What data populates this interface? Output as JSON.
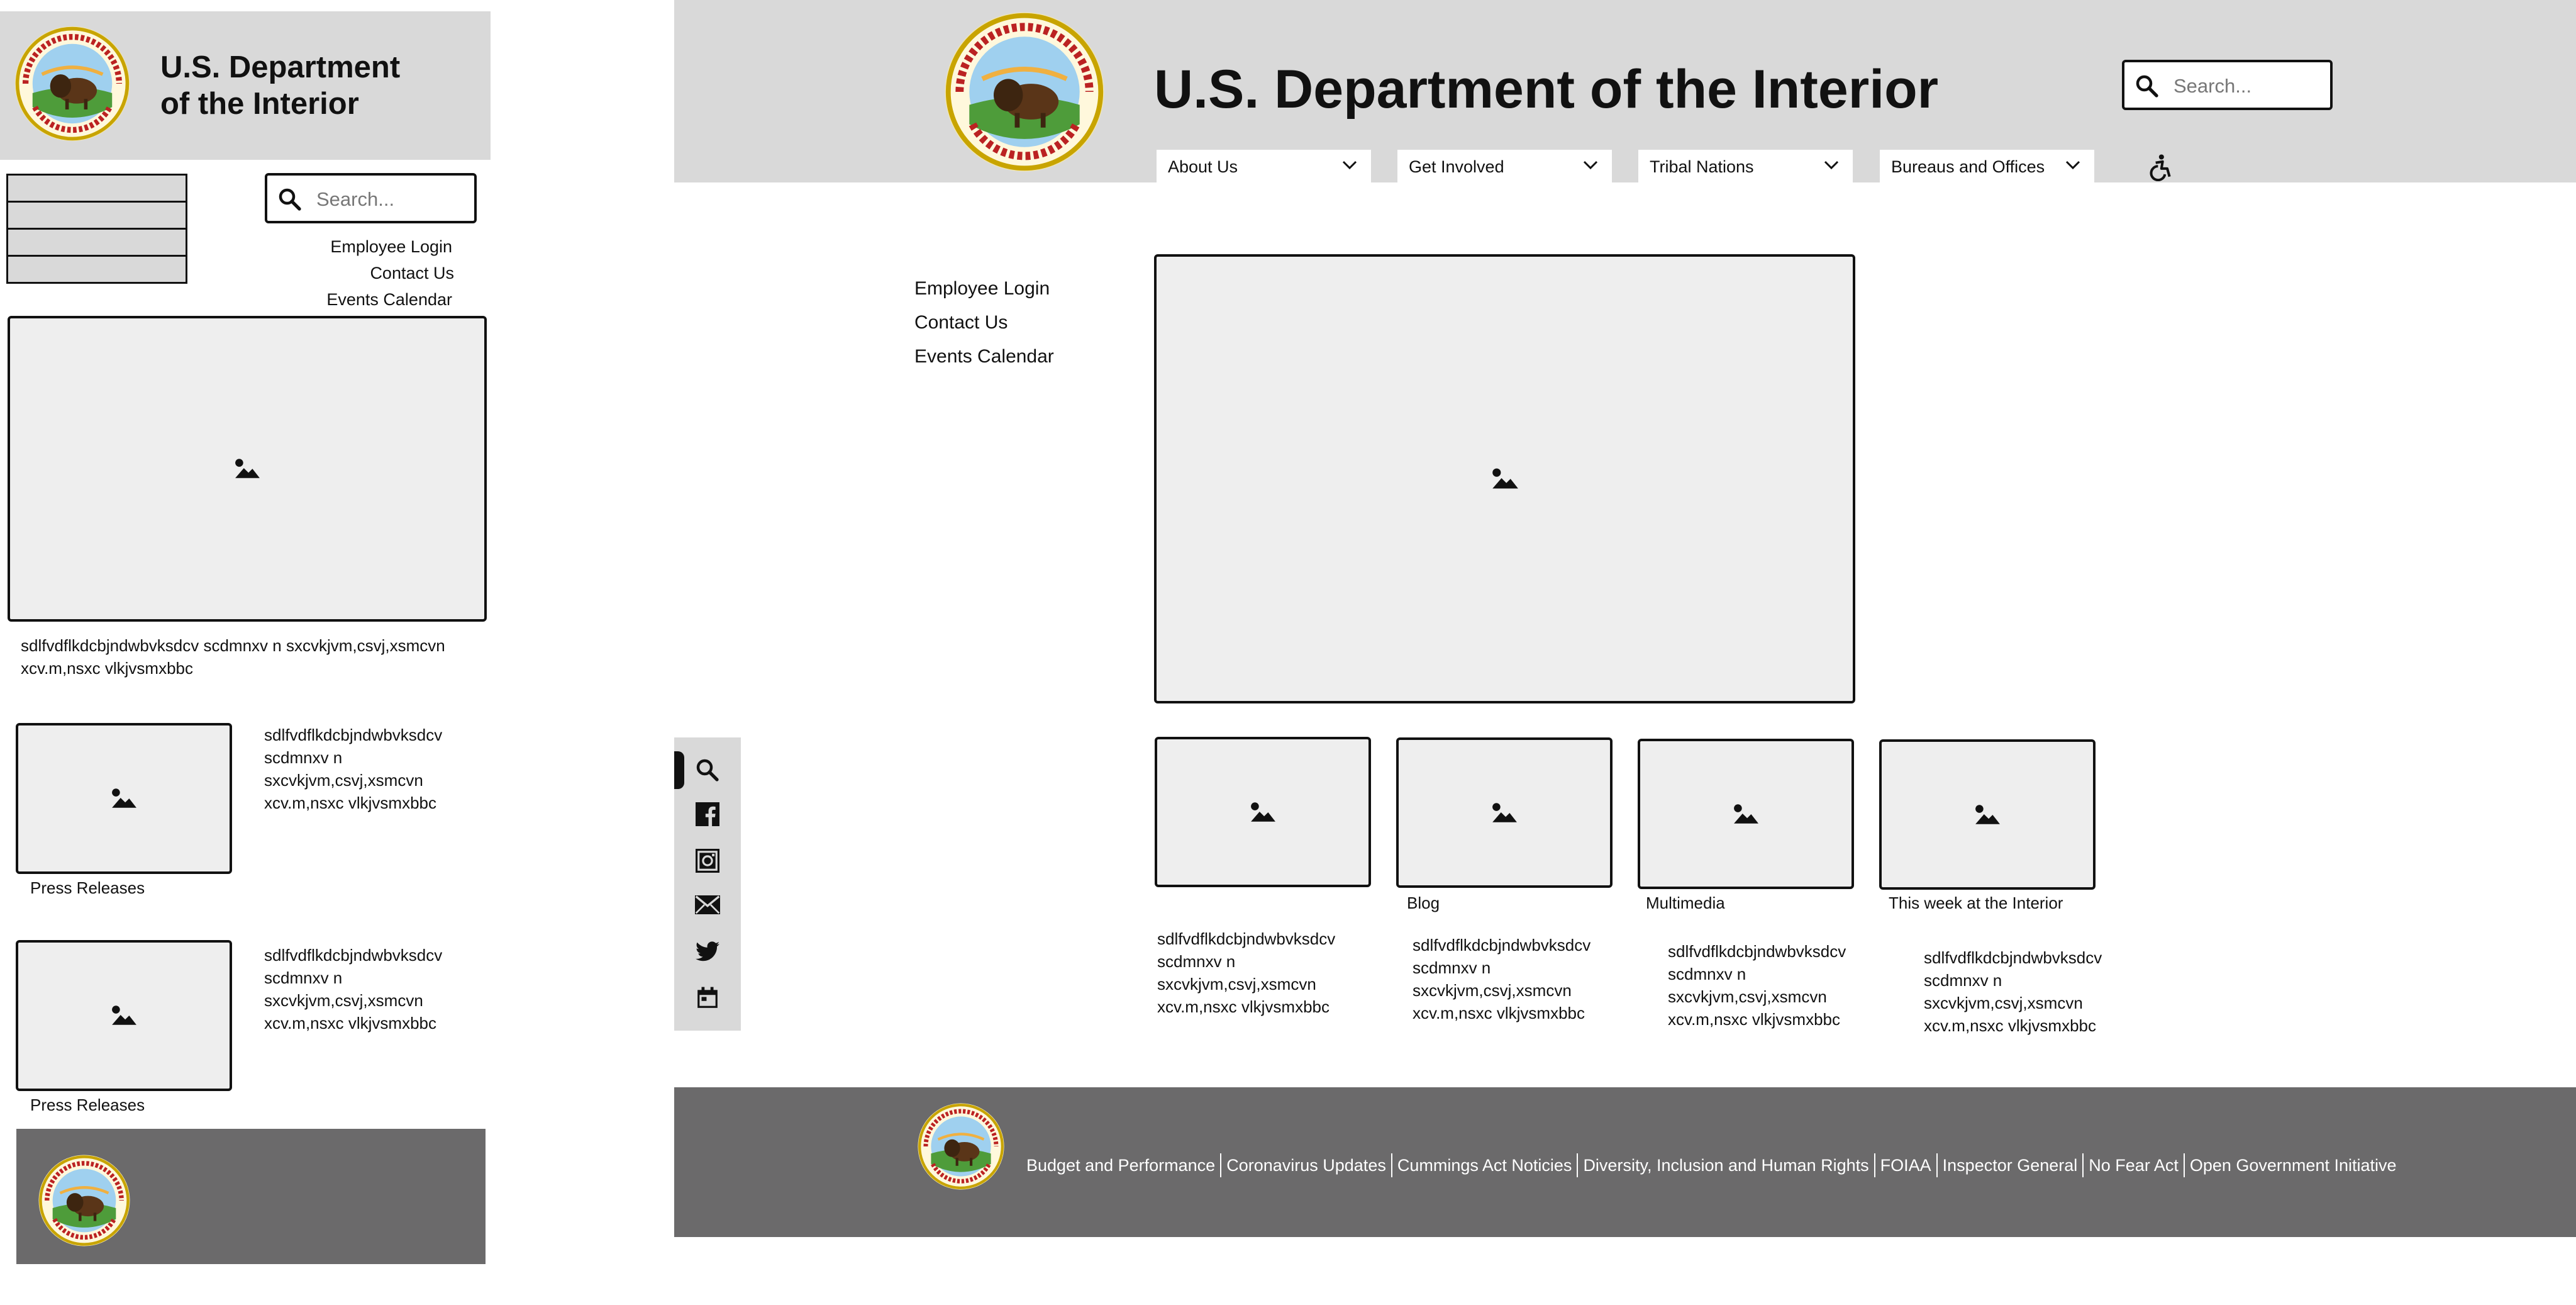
{
  "site": {
    "title_line1": "U.S. Department",
    "title_line2": "of the Interior",
    "title_full": "U.S. Department of the Interior"
  },
  "search": {
    "placeholder": "Search..."
  },
  "nav": {
    "items": [
      {
        "label": "About Us"
      },
      {
        "label": "Get Involved"
      },
      {
        "label": "Tribal Nations"
      },
      {
        "label": "Bureaus and Offices"
      }
    ]
  },
  "quick_links": {
    "employee_login": "Employee Login",
    "contact_us": "Contact Us",
    "events_calendar": "Events Calendar"
  },
  "mobile": {
    "hero_text": "sdlfvdflkdcbjndwbvksdcv scdmnxv n sxcvkjvm,csvj,xsmcvn xcv.m,nsxc vlkjvsmxbbc",
    "cards": [
      {
        "text": "sdlfvdflkdcbjndwbvksdcv scdmnxv n sxcvkjvm,csvj,xsmcvn xcv.m,nsxc vlkjvsmxbbc",
        "caption": "Press Releases"
      },
      {
        "text": "sdlfvdflkdcbjndwbvksdcv scdmnxv n sxcvkjvm,csvj,xsmcvn xcv.m,nsxc vlkjvsmxbbc",
        "caption": "Press Releases"
      }
    ]
  },
  "desktop": {
    "cards": [
      {
        "caption": "",
        "text": "sdlfvdflkdcbjndwbvksdcv scdmnxv n sxcvkjvm,csvj,xsmcvn xcv.m,nsxc vlkjvsmxbbc"
      },
      {
        "caption": "Blog",
        "text": "sdlfvdflkdcbjndwbvksdcv scdmnxv n sxcvkjvm,csvj,xsmcvn xcv.m,nsxc vlkjvsmxbbc"
      },
      {
        "caption": "Multimedia",
        "text": "sdlfvdflkdcbjndwbvksdcv scdmnxv n sxcvkjvm,csvj,xsmcvn xcv.m,nsxc vlkjvsmxbbc"
      },
      {
        "caption": "This week at the Interior",
        "text": "sdlfvdflkdcbjndwbvksdcv scdmnxv n sxcvkjvm,csvj,xsmcvn xcv.m,nsxc vlkjvsmxbbc"
      }
    ]
  },
  "social_icons": [
    "search-icon",
    "facebook-icon",
    "instagram-icon",
    "mail-icon",
    "twitter-icon",
    "calendar-icon"
  ],
  "footer": {
    "links": [
      "Budget and Performance",
      "Coronavirus Updates",
      "Cummings Act Noticies",
      "Diversity, Inclusion and Human Rights",
      "FOIAA",
      "Inspector General",
      "No Fear Act",
      "Open Government Initiative"
    ]
  },
  "colors": {
    "header_bg": "#d9d9d9",
    "footer_bg": "#6b6a6b",
    "placeholder_bg": "#eeeeee",
    "text": "#111111"
  }
}
